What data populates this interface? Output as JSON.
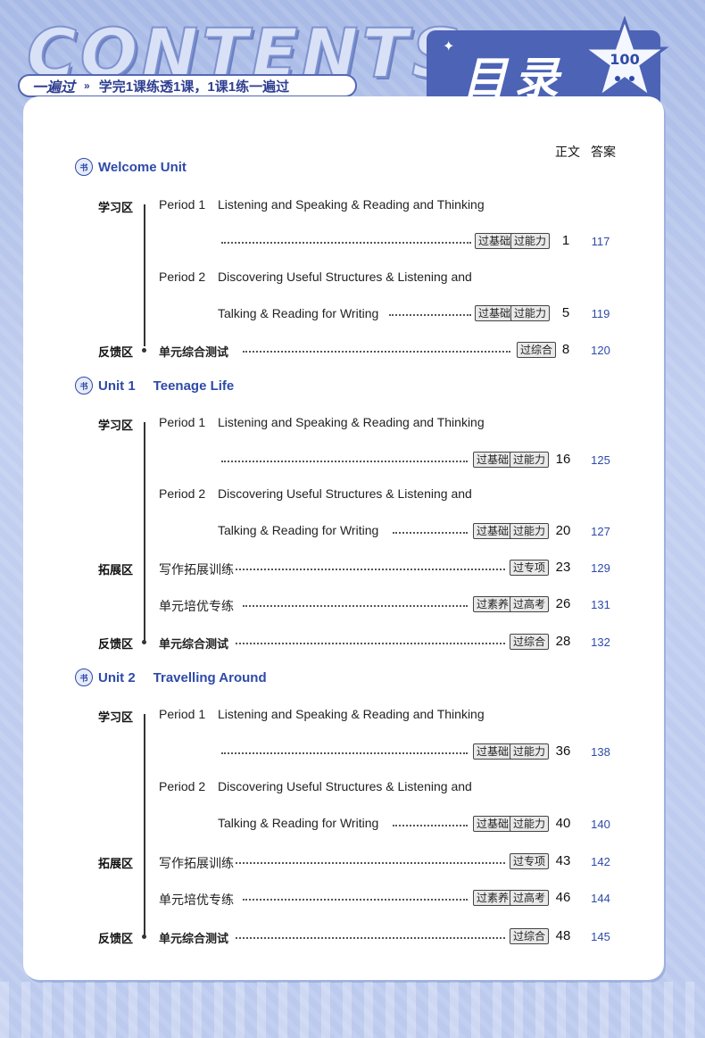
{
  "header": {
    "contents_word": "CONTENTS",
    "slogan_key": "一遍过",
    "slogan_arrow": "»",
    "slogan_text": "学完1课练透1课，1课1练一遍过",
    "title_cn": "目录",
    "star_text": "100"
  },
  "columns": {
    "body": "正文",
    "answer": "答案"
  },
  "units": [
    {
      "name": "Welcome Unit",
      "subtitle": ""
    },
    {
      "name": "Unit 1",
      "subtitle": "Teenage Life"
    },
    {
      "name": "Unit 2",
      "subtitle": "Travelling Around"
    }
  ],
  "zones": {
    "study": "学习区",
    "extend": "拓展区",
    "feedback": "反馈区"
  },
  "entries": {
    "p1_label": "Period 1",
    "p1_title": "Listening and Speaking & Reading and Thinking",
    "p2_label": "Period 2",
    "p2_title_a": "Discovering Useful Structures & Listening and",
    "p2_title_b": "Talking & Reading for Writing",
    "writing": "写作拓展训练",
    "special": "单元培优专练",
    "test": "单元综合测试"
  },
  "tags": {
    "basic": "过基础",
    "ability": "过能力",
    "synthesis": "过综合",
    "topic": "过专项",
    "literacy": "过素养",
    "gaokao": "过高考"
  },
  "pages": {
    "welcome": {
      "p1": [
        "1",
        "117"
      ],
      "p2": [
        "5",
        "119"
      ],
      "test": [
        "8",
        "120"
      ]
    },
    "unit1": {
      "p1": [
        "16",
        "125"
      ],
      "p2": [
        "20",
        "127"
      ],
      "writing": [
        "23",
        "129"
      ],
      "special": [
        "26",
        "131"
      ],
      "test": [
        "28",
        "132"
      ]
    },
    "unit2": {
      "p1": [
        "36",
        "138"
      ],
      "p2": [
        "40",
        "140"
      ],
      "writing": [
        "43",
        "142"
      ],
      "special": [
        "46",
        "144"
      ],
      "test": [
        "48",
        "145"
      ]
    }
  },
  "colors": {
    "accent": "#2e4aa8",
    "tab": "#4d63b6",
    "background": "#b9c8ea"
  }
}
